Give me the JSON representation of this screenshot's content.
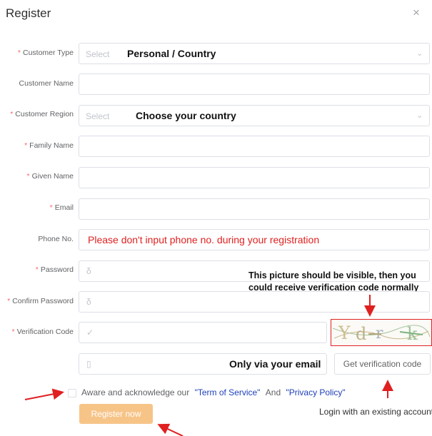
{
  "dialog": {
    "title": "Register",
    "close_glyph": "×"
  },
  "required_mark": "*",
  "form": {
    "customer_type": {
      "label": "Customer Type",
      "required": true,
      "placeholder": "Select",
      "annotation": "Personal / Country"
    },
    "customer_name": {
      "label": "Customer Name",
      "required": false
    },
    "customer_region": {
      "label": "Customer Region",
      "required": true,
      "placeholder": "Select",
      "annotation": "Choose your country"
    },
    "family_name": {
      "label": "Family Name",
      "required": true
    },
    "given_name": {
      "label": "Given Name",
      "required": true
    },
    "email": {
      "label": "Email",
      "required": true
    },
    "phone": {
      "label": "Phone No.",
      "required": false,
      "annotation": "Please don't input phone no. during your registration"
    },
    "password": {
      "label": "Password",
      "required": true,
      "icon": "lock-icon"
    },
    "confirm_password": {
      "label": "Confirm Password",
      "required": true,
      "icon": "lock-icon"
    },
    "verification_code": {
      "label": "Verification Code",
      "required": true,
      "icon": "check-icon",
      "captcha_text": "Ydr k"
    },
    "email_code": {
      "icon": "mobile-icon",
      "annotation": "Only via your email",
      "button_label": "Get verification code"
    }
  },
  "captcha_note": {
    "line1": "This picture should be visible, then you",
    "line2": "could receive verification code normally"
  },
  "agreement": {
    "prefix": "Aware and acknowledge our",
    "term_link": "\"Term of Service\"",
    "and": "And",
    "privacy_link": "\"Privacy Policy\""
  },
  "actions": {
    "register_label": "Register now",
    "login_link": "Login with an existing account"
  },
  "colors": {
    "required": "#f56c6c",
    "annotation_red": "#e02020",
    "link": "#1f3fb8",
    "register_button": "#f7c488",
    "border": "#dcdfe6"
  }
}
